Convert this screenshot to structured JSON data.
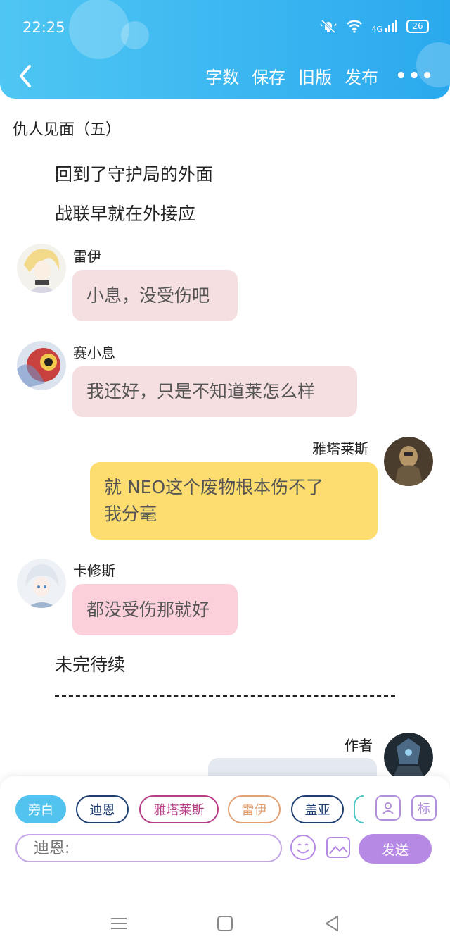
{
  "status": {
    "time": "22:25",
    "network": "4G",
    "battery": "26"
  },
  "nav": {
    "actions": [
      "字数",
      "保存",
      "旧版",
      "发布"
    ],
    "more": "•••"
  },
  "story": {
    "chapter_title": "仇人见面（五）",
    "narration": [
      "回到了守护局的外面",
      "战联早就在外接应"
    ],
    "messages": [
      {
        "sender": "雷伊",
        "text": "小息，没受伤吧",
        "side": "left",
        "color": "#f6dfe0"
      },
      {
        "sender": "赛小息",
        "text": "我还好，只是不知道莱怎么样",
        "side": "left",
        "color": "#f6dfe0"
      },
      {
        "sender": "雅塔莱斯",
        "text": [
          "就 NEO这个废物根本伤不了",
          "我分毫"
        ],
        "side": "right",
        "color": "#fddd6f"
      },
      {
        "sender": "卡修斯",
        "text": "都没受伤那就好",
        "side": "left",
        "color": "#fbd0db"
      }
    ],
    "ending": "未完待续",
    "author_label": "作者"
  },
  "composer": {
    "roles": [
      "旁白",
      "迪恩",
      "雅塔莱斯",
      "雷伊",
      "盖亚"
    ],
    "tool_mark": "标",
    "input_placeholder": "迪恩:",
    "send_label": "发送"
  }
}
